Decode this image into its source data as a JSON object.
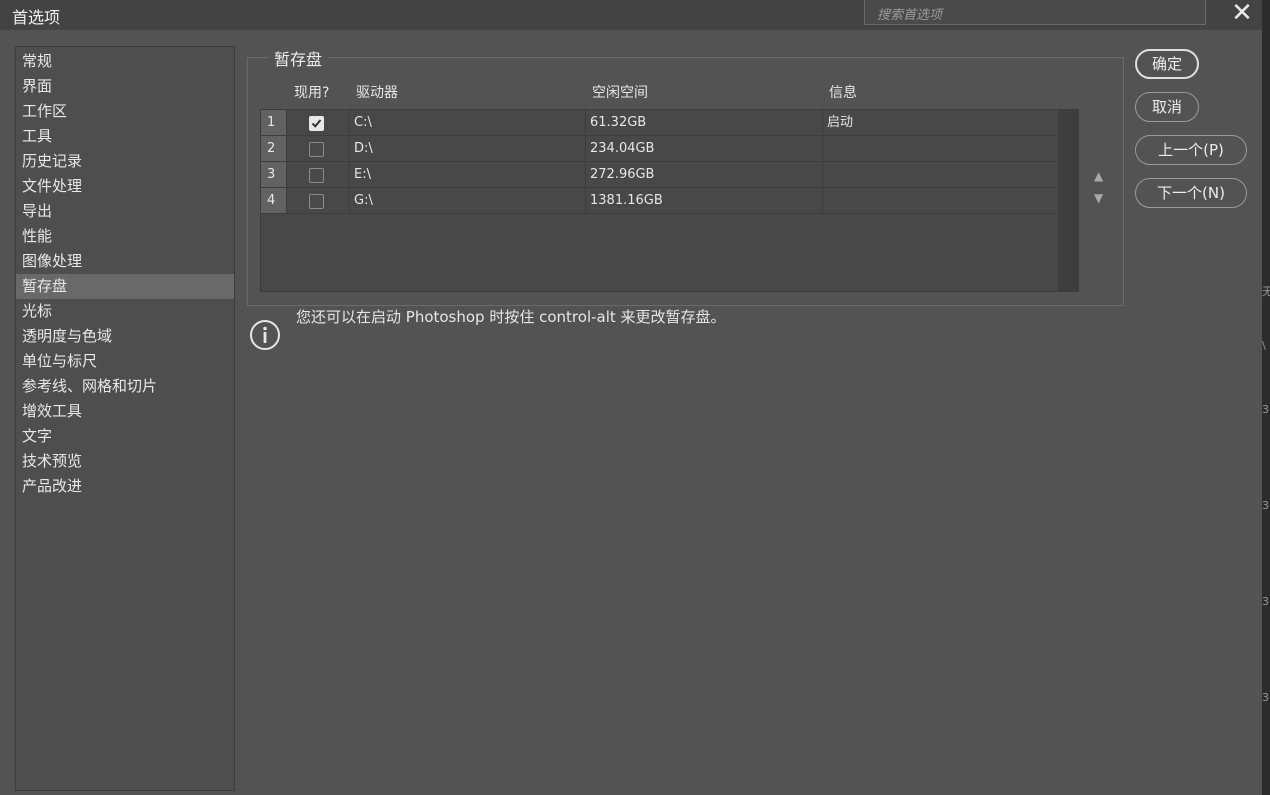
{
  "window": {
    "title": "首选项",
    "search_placeholder": "搜索首选项",
    "close_glyph": "✕"
  },
  "sidebar": {
    "items": [
      {
        "label": "常规"
      },
      {
        "label": "界面"
      },
      {
        "label": "工作区"
      },
      {
        "label": "工具"
      },
      {
        "label": "历史记录"
      },
      {
        "label": "文件处理"
      },
      {
        "label": "导出"
      },
      {
        "label": "性能"
      },
      {
        "label": "图像处理"
      },
      {
        "label": "暂存盘",
        "active": true
      },
      {
        "label": "光标"
      },
      {
        "label": "透明度与色域"
      },
      {
        "label": "单位与标尺"
      },
      {
        "label": "参考线、网格和切片"
      },
      {
        "label": "增效工具"
      },
      {
        "label": "文字"
      },
      {
        "label": "技术预览"
      },
      {
        "label": "产品改进"
      }
    ]
  },
  "scratch": {
    "legend": "暂存盘",
    "columns": {
      "active": "现用?",
      "drive": "驱动器",
      "free": "空闲空间",
      "info": "信息"
    },
    "rows": [
      {
        "index": "1",
        "checked": true,
        "drive": "C:\\",
        "free": "61.32GB",
        "info": "启动"
      },
      {
        "index": "2",
        "checked": false,
        "drive": "D:\\",
        "free": "234.04GB",
        "info": ""
      },
      {
        "index": "3",
        "checked": false,
        "drive": "E:\\",
        "free": "272.96GB",
        "info": ""
      },
      {
        "index": "4",
        "checked": false,
        "drive": "G:\\",
        "free": "1381.16GB",
        "info": ""
      }
    ],
    "move_up": "▲",
    "move_down": "▼",
    "tip": "您还可以在启动 Photoshop 时按住 control-alt 来更改暂存盘。"
  },
  "buttons": {
    "ok": "确定",
    "cancel": "取消",
    "prev": "上一个(P)",
    "next": "下一个(N)"
  },
  "right_edge_glyphs": [
    "无",
    "\\",
    "3",
    "3",
    "3",
    "3",
    "3",
    "3",
    "3"
  ],
  "colors": {
    "dialog_bg": "#535353",
    "sidebar_bg": "#4e4e4e",
    "active_item": "#696969",
    "text": "#e6e6e6"
  }
}
